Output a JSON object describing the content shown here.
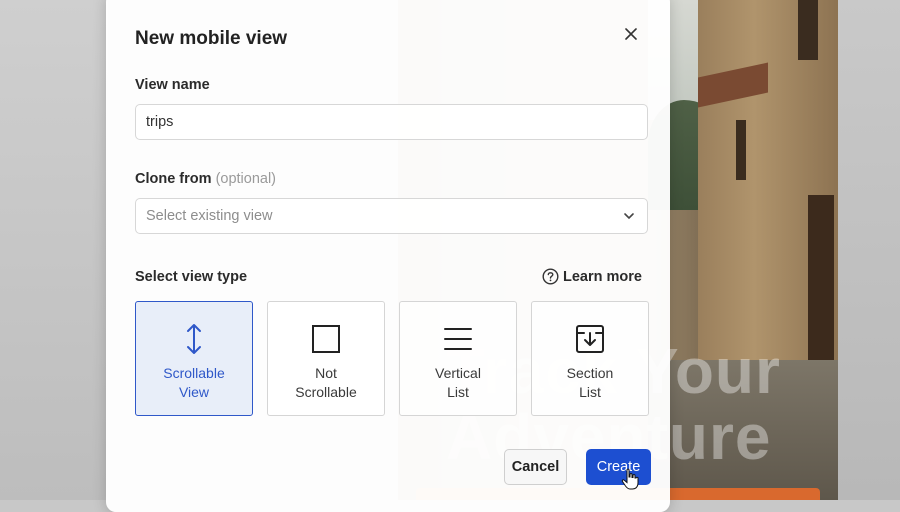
{
  "dialog": {
    "title": "New mobile view",
    "view_name": {
      "label": "View name",
      "value": "trips"
    },
    "clone_from": {
      "label": "Clone from",
      "optional": "(optional)",
      "placeholder": "Select existing view"
    },
    "view_type": {
      "label": "Select view type",
      "learn_more": "Learn more",
      "options": [
        {
          "line1": "Scrollable",
          "line2": "View",
          "selected": true,
          "icon": "vertical-arrows-icon"
        },
        {
          "line1": "Not",
          "line2": "Scrollable",
          "selected": false,
          "icon": "square-icon"
        },
        {
          "line1": "Vertical",
          "line2": "List",
          "selected": false,
          "icon": "list-lines-icon"
        },
        {
          "line1": "Section",
          "line2": "List",
          "selected": false,
          "icon": "section-box-icon"
        }
      ]
    },
    "buttons": {
      "cancel": "Cancel",
      "create": "Create"
    },
    "colors": {
      "primary": "#1d4fd1",
      "selected_border": "#2f58c9",
      "selected_bg": "#e8eef9"
    }
  },
  "background": {
    "promo_line1": "Track Your",
    "promo_line2": "Adventure"
  }
}
